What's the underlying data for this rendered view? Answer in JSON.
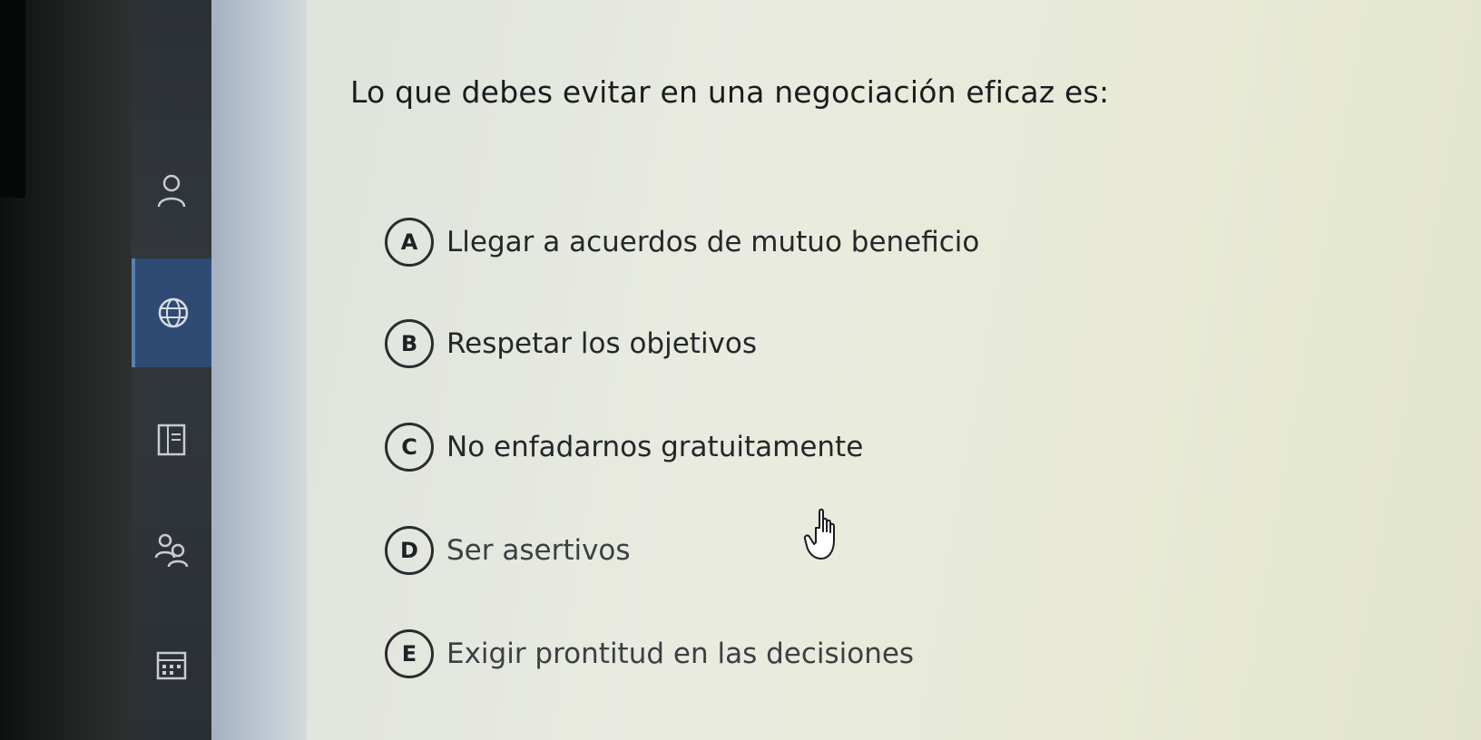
{
  "question": "Lo que debes evitar en una negociación eficaz es:",
  "options": [
    {
      "letter": "A",
      "text": "Llegar a acuerdos de mutuo beneficio"
    },
    {
      "letter": "B",
      "text": "Respetar los objetivos"
    },
    {
      "letter": "C",
      "text": "No enfadarnos gratuitamente"
    },
    {
      "letter": "D",
      "text": "Ser asertivos"
    },
    {
      "letter": "E",
      "text": "Exigir prontitud en las decisiones"
    }
  ],
  "sidebar": {
    "items": [
      {
        "icon": "person-icon"
      },
      {
        "icon": "globe-icon",
        "active": true
      },
      {
        "icon": "document-icon"
      },
      {
        "icon": "people-icon"
      },
      {
        "icon": "calendar-icon"
      }
    ]
  },
  "colors": {
    "sidebar_active": "#2f4a73",
    "content_bg": "#e9ebe1",
    "text": "#1a1d1f"
  }
}
